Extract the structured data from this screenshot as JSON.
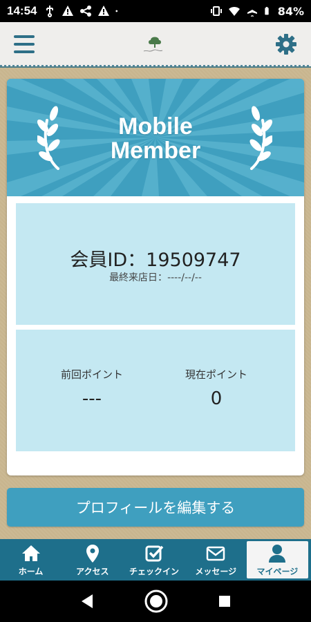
{
  "status_bar": {
    "time": "14:54",
    "battery": "84%"
  },
  "header": {
    "menu_icon": "hamburger-icon",
    "settings_icon": "gear-icon",
    "logo": "brand-logo"
  },
  "card": {
    "banner_title_line1": "Mobile",
    "banner_title_line2": "Member",
    "member_id_label": "会員ID：",
    "member_id_value": "19509747",
    "last_visit_label": "最終来店日：",
    "last_visit_value": "----/--/--",
    "prev_points_label": "前回ポイント",
    "prev_points_value": "---",
    "curr_points_label": "現在ポイント",
    "curr_points_value": "0"
  },
  "edit_profile_label": "プロフィールを編集する",
  "bottom_nav": {
    "items": [
      {
        "label": "ホーム",
        "icon": "home-icon"
      },
      {
        "label": "アクセス",
        "icon": "map-pin-icon"
      },
      {
        "label": "チェックイン",
        "icon": "checkbox-icon"
      },
      {
        "label": "メッセージ",
        "icon": "envelope-icon"
      },
      {
        "label": "マイページ",
        "icon": "user-icon"
      }
    ],
    "active_index": 4
  },
  "colors": {
    "primary": "#3f9fbf",
    "nav": "#1e6f8b",
    "panel": "#c4e8f2"
  }
}
